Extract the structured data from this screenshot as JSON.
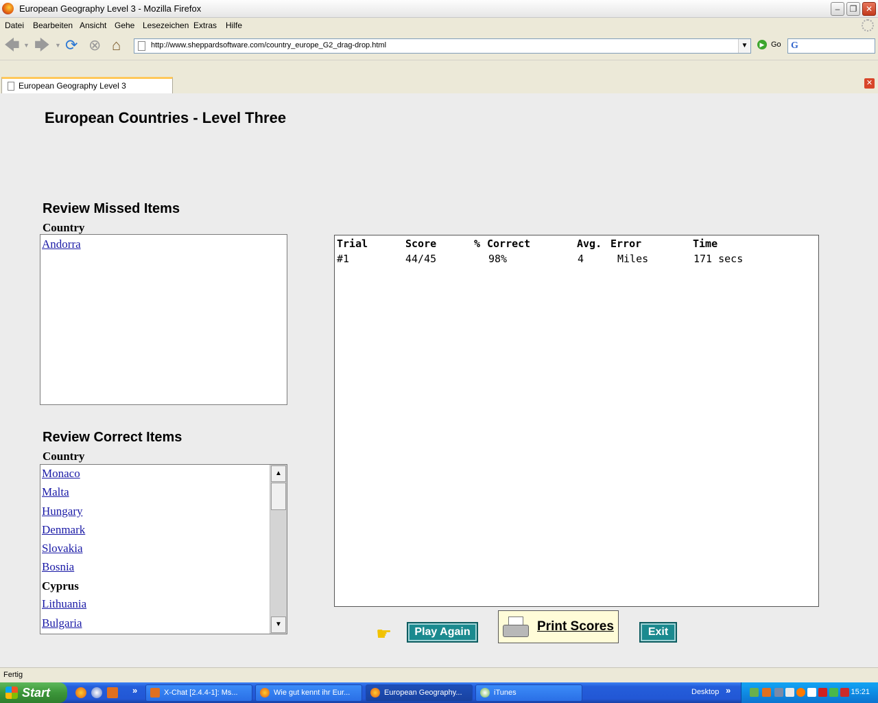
{
  "window": {
    "title": "European Geography Level 3 - Mozilla Firefox"
  },
  "menu": [
    "Datei",
    "Bearbeiten",
    "Ansicht",
    "Gehe",
    "Lesezeichen",
    "Extras",
    "Hilfe"
  ],
  "nav": {
    "url": "http://www.sheppardsoftware.com/country_europe_G2_drag-drop.html",
    "go_label": "Go",
    "search_logo": "G"
  },
  "tab": {
    "label": "European Geography Level 3"
  },
  "page": {
    "title": "European Countries - Level Three",
    "missed": {
      "heading": "Review Missed Items",
      "col": "Country",
      "items": [
        "Andorra"
      ]
    },
    "correct": {
      "heading": "Review Correct Items",
      "col": "Country",
      "items": [
        "Monaco",
        "Malta",
        "Hungary",
        "Denmark",
        "Slovakia",
        "Bosnia",
        "Cyprus",
        "Lithuania",
        "Bulgaria"
      ],
      "plain_item": "Cyprus"
    },
    "scores": {
      "headers": [
        "Trial",
        "Score",
        "%",
        "Correct",
        "Avg.",
        "Error",
        "Time"
      ],
      "rows": [
        {
          "trial": "#1",
          "score": "44/45",
          "pct": "98%",
          "avg": "4",
          "unit": "Miles",
          "time": "171 secs"
        }
      ]
    },
    "buttons": {
      "play_again": "Play Again",
      "print_scores": "Print Scores",
      "exit": "Exit"
    }
  },
  "status": "Fertig",
  "taskbar": {
    "start": "Start",
    "items": [
      "X-Chat [2.4.4-1]: Ms...",
      "Wie gut kennt ihr Eur...",
      "European Geography...",
      "iTunes"
    ],
    "desktop": "Desktop",
    "clock": "15:21"
  },
  "colors": {
    "button_teal": "#1b8a8f",
    "link": "#1a1aa6",
    "taskbar_blue": "#245edb"
  }
}
